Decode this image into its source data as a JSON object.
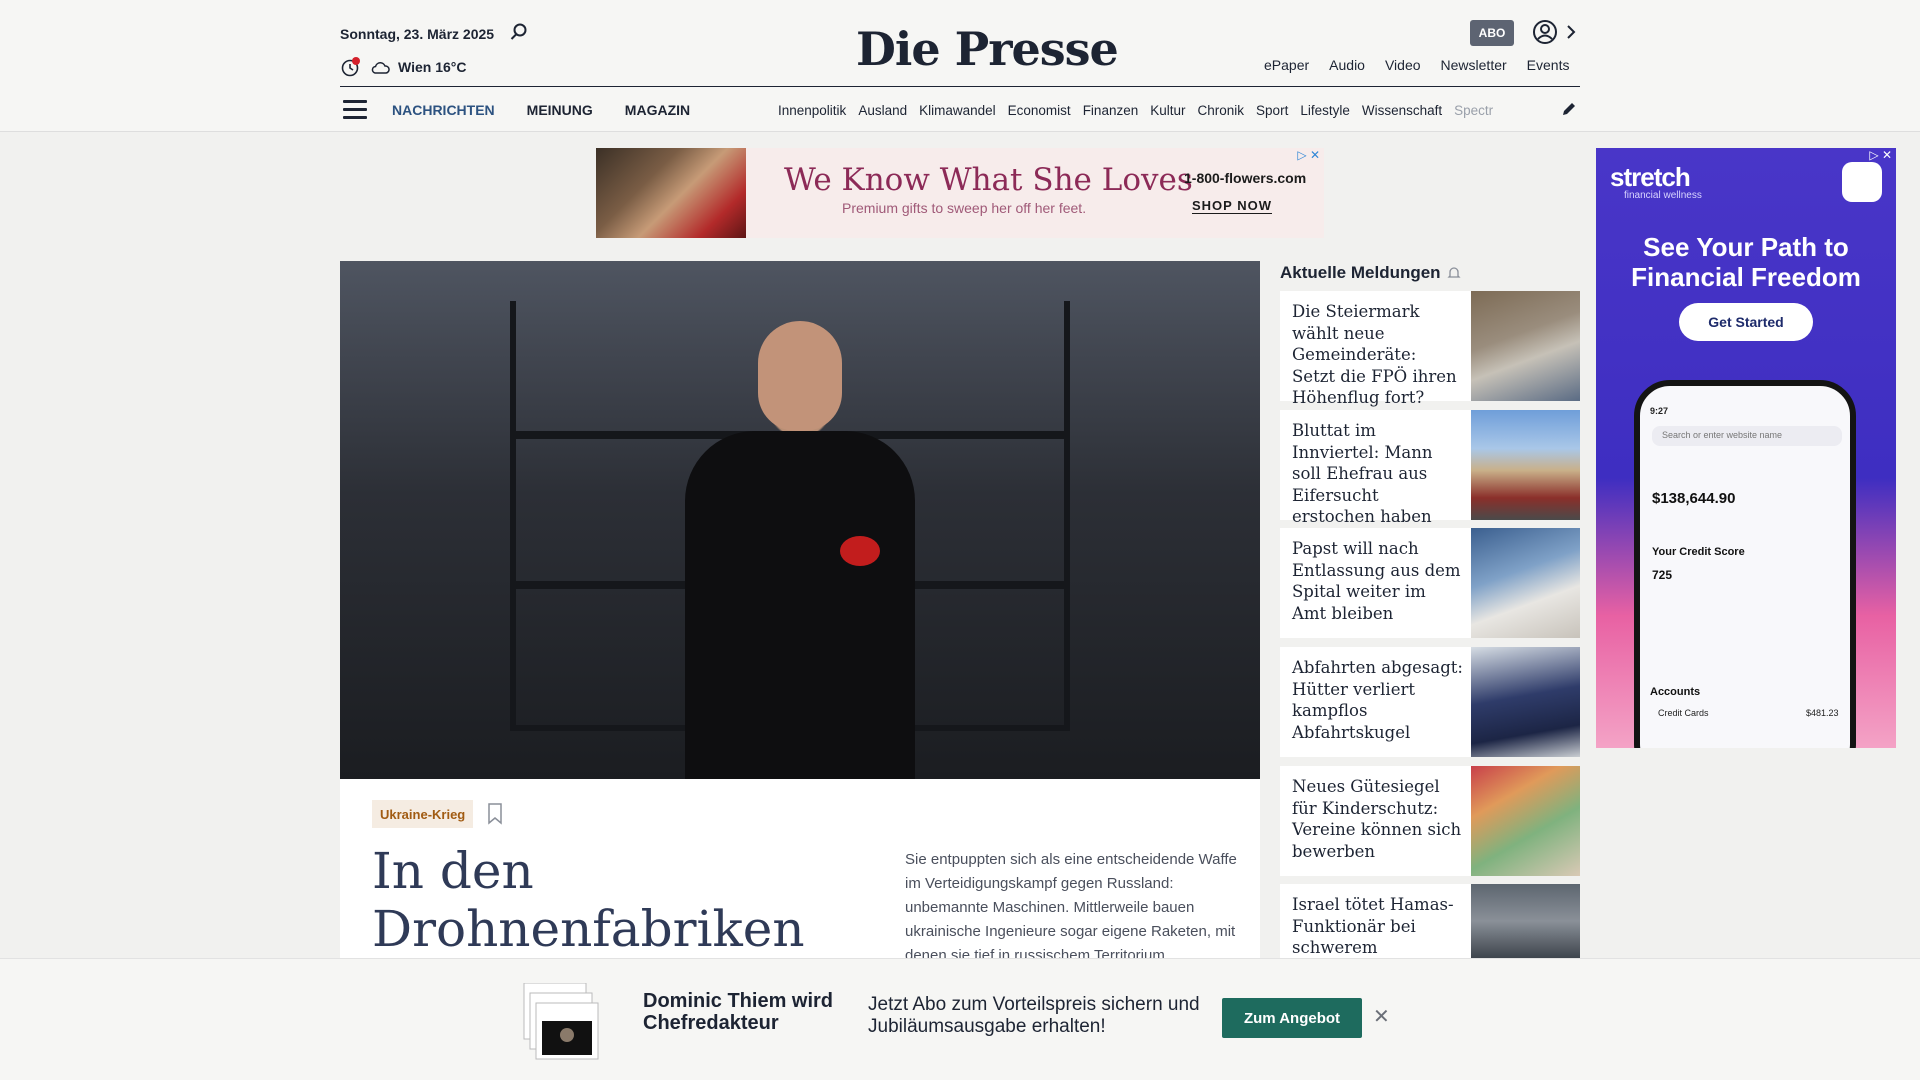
{
  "header": {
    "date": "Sonntag, 23. März 2025",
    "weather": "Wien 16°C",
    "logo": "Die Presse",
    "abo": "ABO",
    "util_links": [
      "ePaper",
      "Audio",
      "Video",
      "Newsletter",
      "Events"
    ]
  },
  "nav": {
    "main": [
      "NACHRICHTEN",
      "MEINUNG",
      "MAGAZIN"
    ],
    "sub": [
      "Innenpolitik",
      "Ausland",
      "Klimawandel",
      "Economist",
      "Finanzen",
      "Kultur",
      "Chronik",
      "Sport",
      "Lifestyle",
      "Wissenschaft",
      "Spectr"
    ]
  },
  "ad_top": {
    "headline": "We Know What She Loves",
    "subline": "Premium gifts to sweep her off her feet.",
    "brand": "1-800-flowers.com",
    "cta": "SHOP NOW"
  },
  "hero": {
    "tag": "Ukraine-Krieg",
    "title": "In den Drohnenfabriken der Ukraine",
    "lead": "Sie entpuppten sich als eine entscheidende Waffe im Verteidigungskampf gegen Russland: unbemannte Maschinen. Mittlerweile bauen ukrainische Ingenieure sogar eigene Raketen, mit denen sie tief in russischem Territorium"
  },
  "sidebar": {
    "heading": "Aktuelle Meldungen",
    "items": [
      {
        "title": "Die Steiermark wählt neue Gemeinderäte: Setzt die FPÖ ihren Höhenflug fort?"
      },
      {
        "title": "Bluttat im Innviertel: Mann soll Ehefrau aus Eifersucht erstochen haben"
      },
      {
        "title": "Papst will nach Entlassung aus dem Spital weiter im Amt bleiben"
      },
      {
        "title": "Abfahrten abgesagt: Hütter verliert kampflos Abfahrtskugel"
      },
      {
        "title": "Neues Gütesiegel für Kinderschutz: Vereine können sich bewerben"
      },
      {
        "title": "Israel tötet Hamas-Funktionär bei schwerem"
      }
    ]
  },
  "ad_right": {
    "brand": "stretch",
    "sub": "financial wellness",
    "headline": "See Your Path to Financial Freedom",
    "cta": "Get Started",
    "phone_time": "9:27",
    "phone_search": "Search or enter website name",
    "balance": "$138,644.90",
    "credit_label": "Your Credit Score",
    "credit_value": "725",
    "accounts_label": "Accounts",
    "account_row": "Credit Cards",
    "account_value": "$481.23"
  },
  "banner": {
    "title": "Dominic Thiem wird Chefredakteur",
    "text": "Jetzt Abo zum Vorteilspreis sichern und Jubiläumsausgabe erhalten!",
    "cta": "Zum Angebot"
  },
  "colors": {
    "nav_active": "#2c5280",
    "tag_text": "#a15b12",
    "banner_button": "#1e6b5e",
    "ad_right_bg": "#4936c8"
  }
}
